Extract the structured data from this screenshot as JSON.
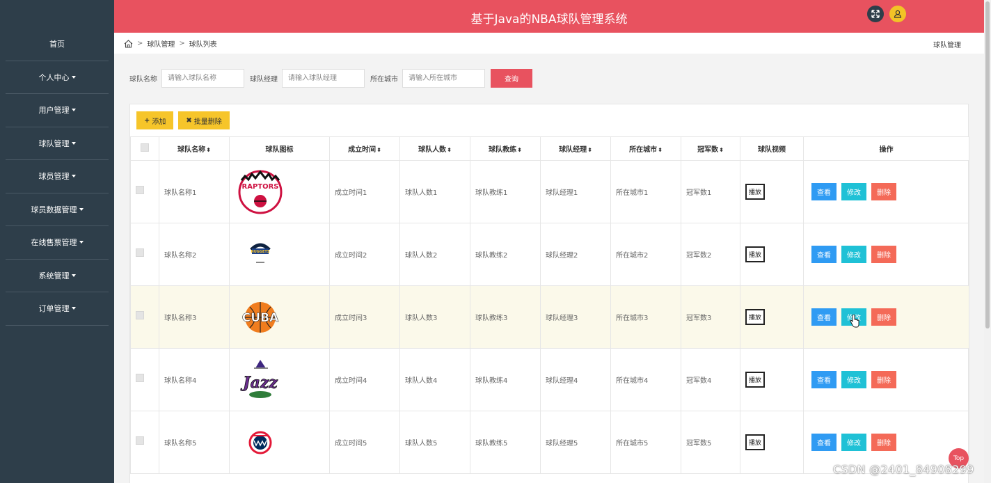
{
  "header": {
    "title": "基于Java的NBA球队管理系统"
  },
  "sidebar": {
    "items": [
      {
        "label": "首页",
        "caret": false
      },
      {
        "label": "个人中心",
        "caret": true
      },
      {
        "label": "用户管理",
        "caret": true
      },
      {
        "label": "球队管理",
        "caret": true
      },
      {
        "label": "球员管理",
        "caret": true
      },
      {
        "label": "球员数据管理",
        "caret": true
      },
      {
        "label": "在线售票管理",
        "caret": true
      },
      {
        "label": "系统管理",
        "caret": true
      },
      {
        "label": "订单管理",
        "caret": true
      }
    ]
  },
  "breadcrumb": {
    "items": [
      "球队管理",
      "球队列表"
    ],
    "right": "球队管理"
  },
  "search": {
    "name_label": "球队名称",
    "name_placeholder": "请输入球队名称",
    "manager_label": "球队经理",
    "manager_placeholder": "请输入球队经理",
    "city_label": "所在城市",
    "city_placeholder": "请输入所在城市",
    "query_label": "查询"
  },
  "toolbar": {
    "add_label": "添加",
    "batch_delete_label": "批量删除"
  },
  "table": {
    "headers": {
      "name": "球队名称",
      "logo": "球队图标",
      "founded": "成立时间",
      "players": "球队人数",
      "coach": "球队教练",
      "manager": "球队经理",
      "city": "所在城市",
      "titles": "冠军数",
      "video": "球队视频",
      "ops": "操作"
    },
    "play_label": "播放",
    "view_label": "查看",
    "edit_label": "修改",
    "delete_label": "删除",
    "rows": [
      {
        "name": "球队名称1",
        "logo": "raptors-logo",
        "founded": "成立时间1",
        "players": "球队人数1",
        "coach": "球队教练1",
        "manager": "球队经理1",
        "city": "所在城市1",
        "titles": "冠军数1"
      },
      {
        "name": "球队名称2",
        "logo": "nuggets-logo",
        "founded": "成立时间2",
        "players": "球队人数2",
        "coach": "球队教练2",
        "manager": "球队经理2",
        "city": "所在城市2",
        "titles": "冠军数2"
      },
      {
        "name": "球队名称3",
        "logo": "cuba-logo",
        "founded": "成立时间3",
        "players": "球队人数3",
        "coach": "球队教练3",
        "manager": "球队经理3",
        "city": "所在城市3",
        "titles": "冠军数3"
      },
      {
        "name": "球队名称4",
        "logo": "jazz-logo",
        "founded": "成立时间4",
        "players": "球队人数4",
        "coach": "球队教练4",
        "manager": "球队经理4",
        "city": "所在城市4",
        "titles": "冠军数4"
      },
      {
        "name": "球队名称5",
        "logo": "wizards-logo",
        "founded": "成立时间5",
        "players": "球队人数5",
        "coach": "球队教练5",
        "manager": "球队经理5",
        "city": "所在城市5",
        "titles": "冠军数5"
      }
    ]
  },
  "top_button": "Top",
  "watermark": "CSDN @2401_84908299",
  "colors": {
    "accent": "#e8525f",
    "sidebar": "#2e3e4a",
    "yellow": "#f6c52a",
    "view": "#2f9bf3",
    "edit": "#1fc1d6",
    "delete": "#f46a58"
  }
}
